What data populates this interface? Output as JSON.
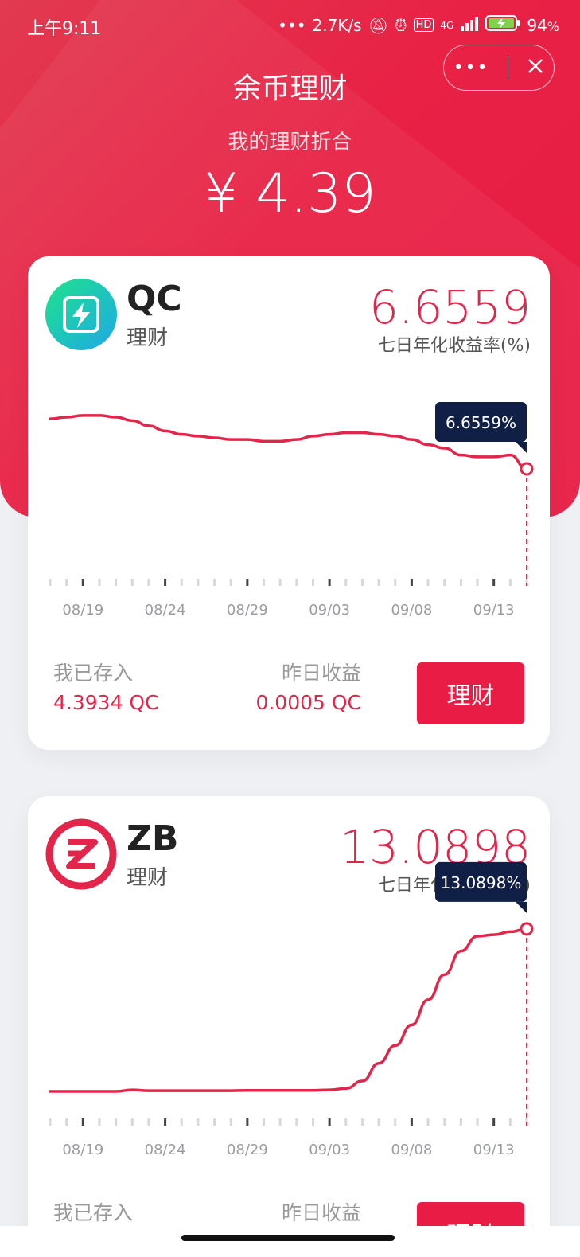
{
  "status_bar": {
    "time": "上午9:11",
    "network_speed": "2.7K/s",
    "hd_badge": "HD",
    "signal_label": "4G",
    "battery": "94"
  },
  "header": {
    "title": "余币理财",
    "total_label": "我的理财折合",
    "total_value": "¥ 4.39"
  },
  "cards": [
    {
      "coin": "QC",
      "subtitle": "理财",
      "rate": "6.6559",
      "rate_label": "七日年化收益率(%)",
      "tooltip": "6.6559%",
      "deposited_label": "我已存入",
      "deposited_value": "4.3934 QC",
      "yesterday_label": "昨日收益",
      "yesterday_value": "0.0005 QC",
      "button_label": "理财"
    },
    {
      "coin": "ZB",
      "subtitle": "理财",
      "rate": "13.0898",
      "rate_label": "七日年化收益率(%)",
      "tooltip": "13.0898%",
      "deposited_label": "我已存入",
      "yesterday_label": "昨日收益",
      "button_label": "理财"
    }
  ],
  "colors": {
    "accent": "#e81c44",
    "line": "#e2254a",
    "tooltip_bg": "#0f1f45"
  },
  "chart_data": [
    {
      "type": "line",
      "x_tick_labels": [
        "08/19",
        "08/24",
        "08/29",
        "09/03",
        "09/08",
        "09/13"
      ],
      "x": [
        "08/17",
        "08/18",
        "08/19",
        "08/20",
        "08/21",
        "08/22",
        "08/23",
        "08/24",
        "08/25",
        "08/26",
        "08/27",
        "08/28",
        "08/29",
        "08/30",
        "08/31",
        "09/01",
        "09/02",
        "09/03",
        "09/04",
        "09/05",
        "09/06",
        "09/07",
        "09/08",
        "09/09",
        "09/10",
        "09/11",
        "09/12",
        "09/13",
        "09/14",
        "09/15"
      ],
      "series": [
        {
          "values": [
            6.95,
            6.96,
            6.97,
            6.97,
            6.96,
            6.94,
            6.91,
            6.88,
            6.86,
            6.85,
            6.84,
            6.83,
            6.83,
            6.82,
            6.82,
            6.83,
            6.85,
            6.86,
            6.87,
            6.87,
            6.86,
            6.85,
            6.83,
            6.8,
            6.78,
            6.74,
            6.73,
            6.73,
            6.74,
            6.66
          ]
        }
      ],
      "ylim": [
        6.0,
        7.2
      ],
      "highlight": {
        "x": "09/15",
        "value": 6.6559
      }
    },
    {
      "type": "line",
      "x_tick_labels": [
        "08/19",
        "08/24",
        "08/29",
        "09/03",
        "09/08",
        "09/13"
      ],
      "x": [
        "08/17",
        "08/18",
        "08/19",
        "08/20",
        "08/21",
        "08/22",
        "08/23",
        "08/24",
        "08/25",
        "08/26",
        "08/27",
        "08/28",
        "08/29",
        "08/30",
        "08/31",
        "09/01",
        "09/02",
        "09/03",
        "09/04",
        "09/05",
        "09/06",
        "09/07",
        "09/08",
        "09/09",
        "09/10",
        "09/11",
        "09/12",
        "09/13",
        "09/14",
        "09/15"
      ],
      "series": [
        {
          "values": [
            2.1,
            2.1,
            2.1,
            2.1,
            2.1,
            2.2,
            2.15,
            2.15,
            2.15,
            2.15,
            2.15,
            2.15,
            2.17,
            2.17,
            2.17,
            2.17,
            2.17,
            2.2,
            2.3,
            2.8,
            4.0,
            5.2,
            6.6,
            8.3,
            10.0,
            11.6,
            12.6,
            12.7,
            12.9,
            13.0898
          ]
        }
      ],
      "ylim": [
        0,
        14
      ],
      "highlight": {
        "x": "09/15",
        "value": 13.0898
      }
    }
  ]
}
